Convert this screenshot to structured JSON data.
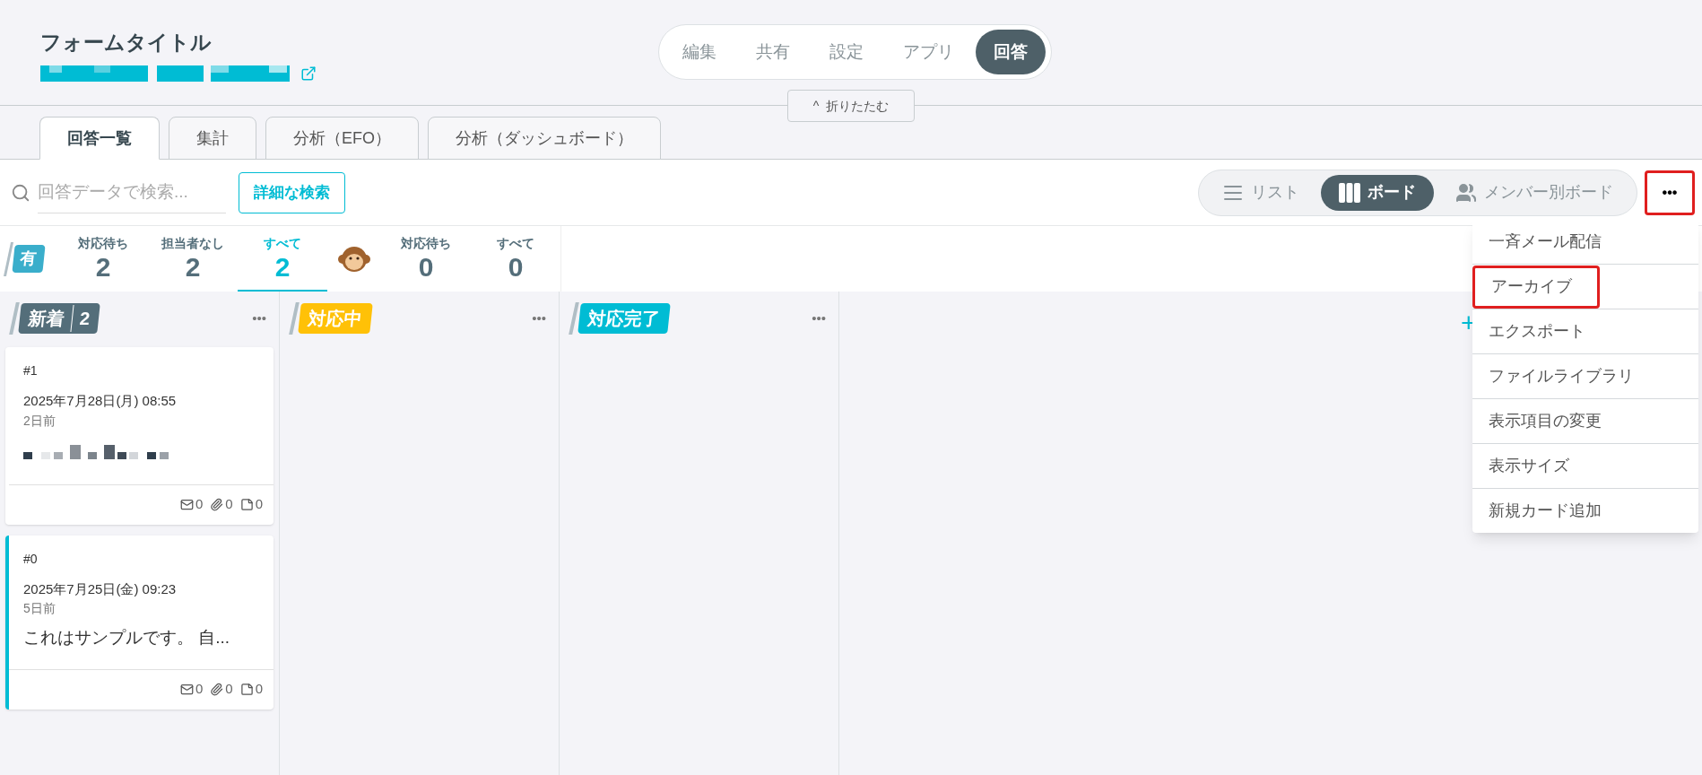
{
  "header": {
    "title": "フォームタイトル"
  },
  "nav": [
    {
      "label": "編集",
      "selected": false
    },
    {
      "label": "共有",
      "selected": false
    },
    {
      "label": "設定",
      "selected": false
    },
    {
      "label": "アプリ",
      "selected": false
    },
    {
      "label": "回答",
      "selected": true
    }
  ],
  "collapse_button": {
    "icon": "^",
    "label": "折りたたむ"
  },
  "tabs": [
    {
      "label": "回答一覧",
      "selected": true
    },
    {
      "label": "集計",
      "selected": false
    },
    {
      "label": "分析（EFO）",
      "selected": false
    },
    {
      "label": "分析（ダッシュボード）",
      "selected": false
    }
  ],
  "search": {
    "placeholder": "回答データで検索..."
  },
  "advanced_search_button": "詳細な検索",
  "views": [
    {
      "kind": "list",
      "label": "リスト",
      "selected": false
    },
    {
      "kind": "board",
      "label": "ボード",
      "selected": true
    },
    {
      "kind": "members",
      "label": "メンバー別ボード",
      "selected": false
    }
  ],
  "more_button": {
    "label": "•••",
    "highlighted": true
  },
  "stat_groups": [
    {
      "kind": "badge",
      "badge": "有",
      "items": [
        {
          "label": "対応待ち",
          "value": "2",
          "selected": false
        },
        {
          "label": "担当者なし",
          "value": "2",
          "selected": false
        },
        {
          "label": "すべて",
          "value": "2",
          "selected": true
        }
      ]
    },
    {
      "kind": "avatar",
      "items": [
        {
          "label": "対応待ち",
          "value": "0",
          "selected": false
        },
        {
          "label": "すべて",
          "value": "0",
          "selected": false
        }
      ]
    }
  ],
  "columns": [
    {
      "label": "新着",
      "count": "2",
      "color": "#546e7a",
      "menu": "•••",
      "cards": [
        {
          "number": "#1",
          "date": "2025年7月28日(月) 08:55",
          "ago": "2日前",
          "kind": "redacted",
          "accent": false,
          "counts": [
            "0",
            "0",
            "0"
          ]
        },
        {
          "number": "#0",
          "date": "2025年7月25日(金) 09:23",
          "ago": "5日前",
          "kind": "text",
          "text": "これはサンプルです。 自...",
          "accent": true,
          "counts": [
            "0",
            "0",
            "0"
          ]
        }
      ]
    },
    {
      "label": "対応中",
      "color": "#ffc107",
      "menu": "•••"
    },
    {
      "label": "対応完了",
      "color": "#00bcd4",
      "menu": "•••"
    }
  ],
  "add_column": "+",
  "menu": [
    {
      "label": "一斉メール配信",
      "highlighted": false
    },
    {
      "label": "アーカイブ",
      "highlighted": true
    },
    {
      "label": "エクスポート",
      "highlighted": false
    },
    {
      "label": "ファイルライブラリ",
      "highlighted": false
    },
    {
      "label": "表示項目の変更",
      "highlighted": false
    },
    {
      "label": "表示サイズ",
      "highlighted": false
    },
    {
      "label": "新規カード追加",
      "highlighted": false
    }
  ]
}
